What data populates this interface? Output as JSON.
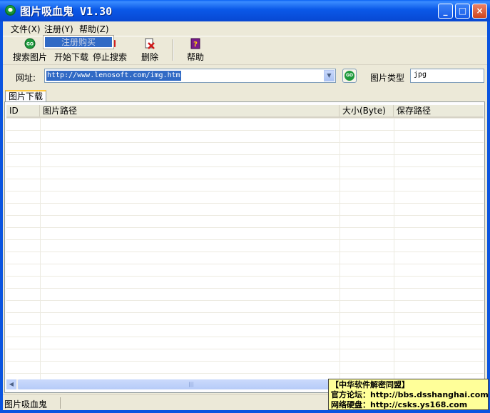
{
  "window": {
    "title": "图片吸血鬼 V1.30",
    "min": "_",
    "max": "□",
    "close": "×"
  },
  "menu": {
    "items": [
      {
        "label": "文件(X)"
      },
      {
        "label": "注册(Y)"
      },
      {
        "label": "帮助(Z)"
      }
    ],
    "dropdown_item": "注册购买"
  },
  "toolbar": {
    "search": "搜索图片",
    "start": "开始下载",
    "stop": "停止搜索",
    "delete": "删除",
    "help": "帮助"
  },
  "address": {
    "label": "网址:",
    "value": "http://www.lenosoft.com/img.htm",
    "go": "GO"
  },
  "image_type": {
    "label": "图片类型",
    "value": "jpg"
  },
  "tab": {
    "label": "图片下载"
  },
  "table": {
    "columns": [
      "ID",
      "图片路径",
      "大小(Byte)",
      "保存路径"
    ],
    "rows": []
  },
  "status": {
    "text": "图片吸血鬼"
  },
  "watermark": {
    "line1": "【中华软件解密同盟】",
    "line2": "官方论坛：http://bbs.dsshanghai.com",
    "line3": "网络硬盘：http://csks.ys168.com"
  },
  "colors": {
    "title_blue": "#0a54e0",
    "selection": "#316ac5",
    "go_green": "#1e9a3c",
    "watermark_bg": "#ffff99"
  }
}
